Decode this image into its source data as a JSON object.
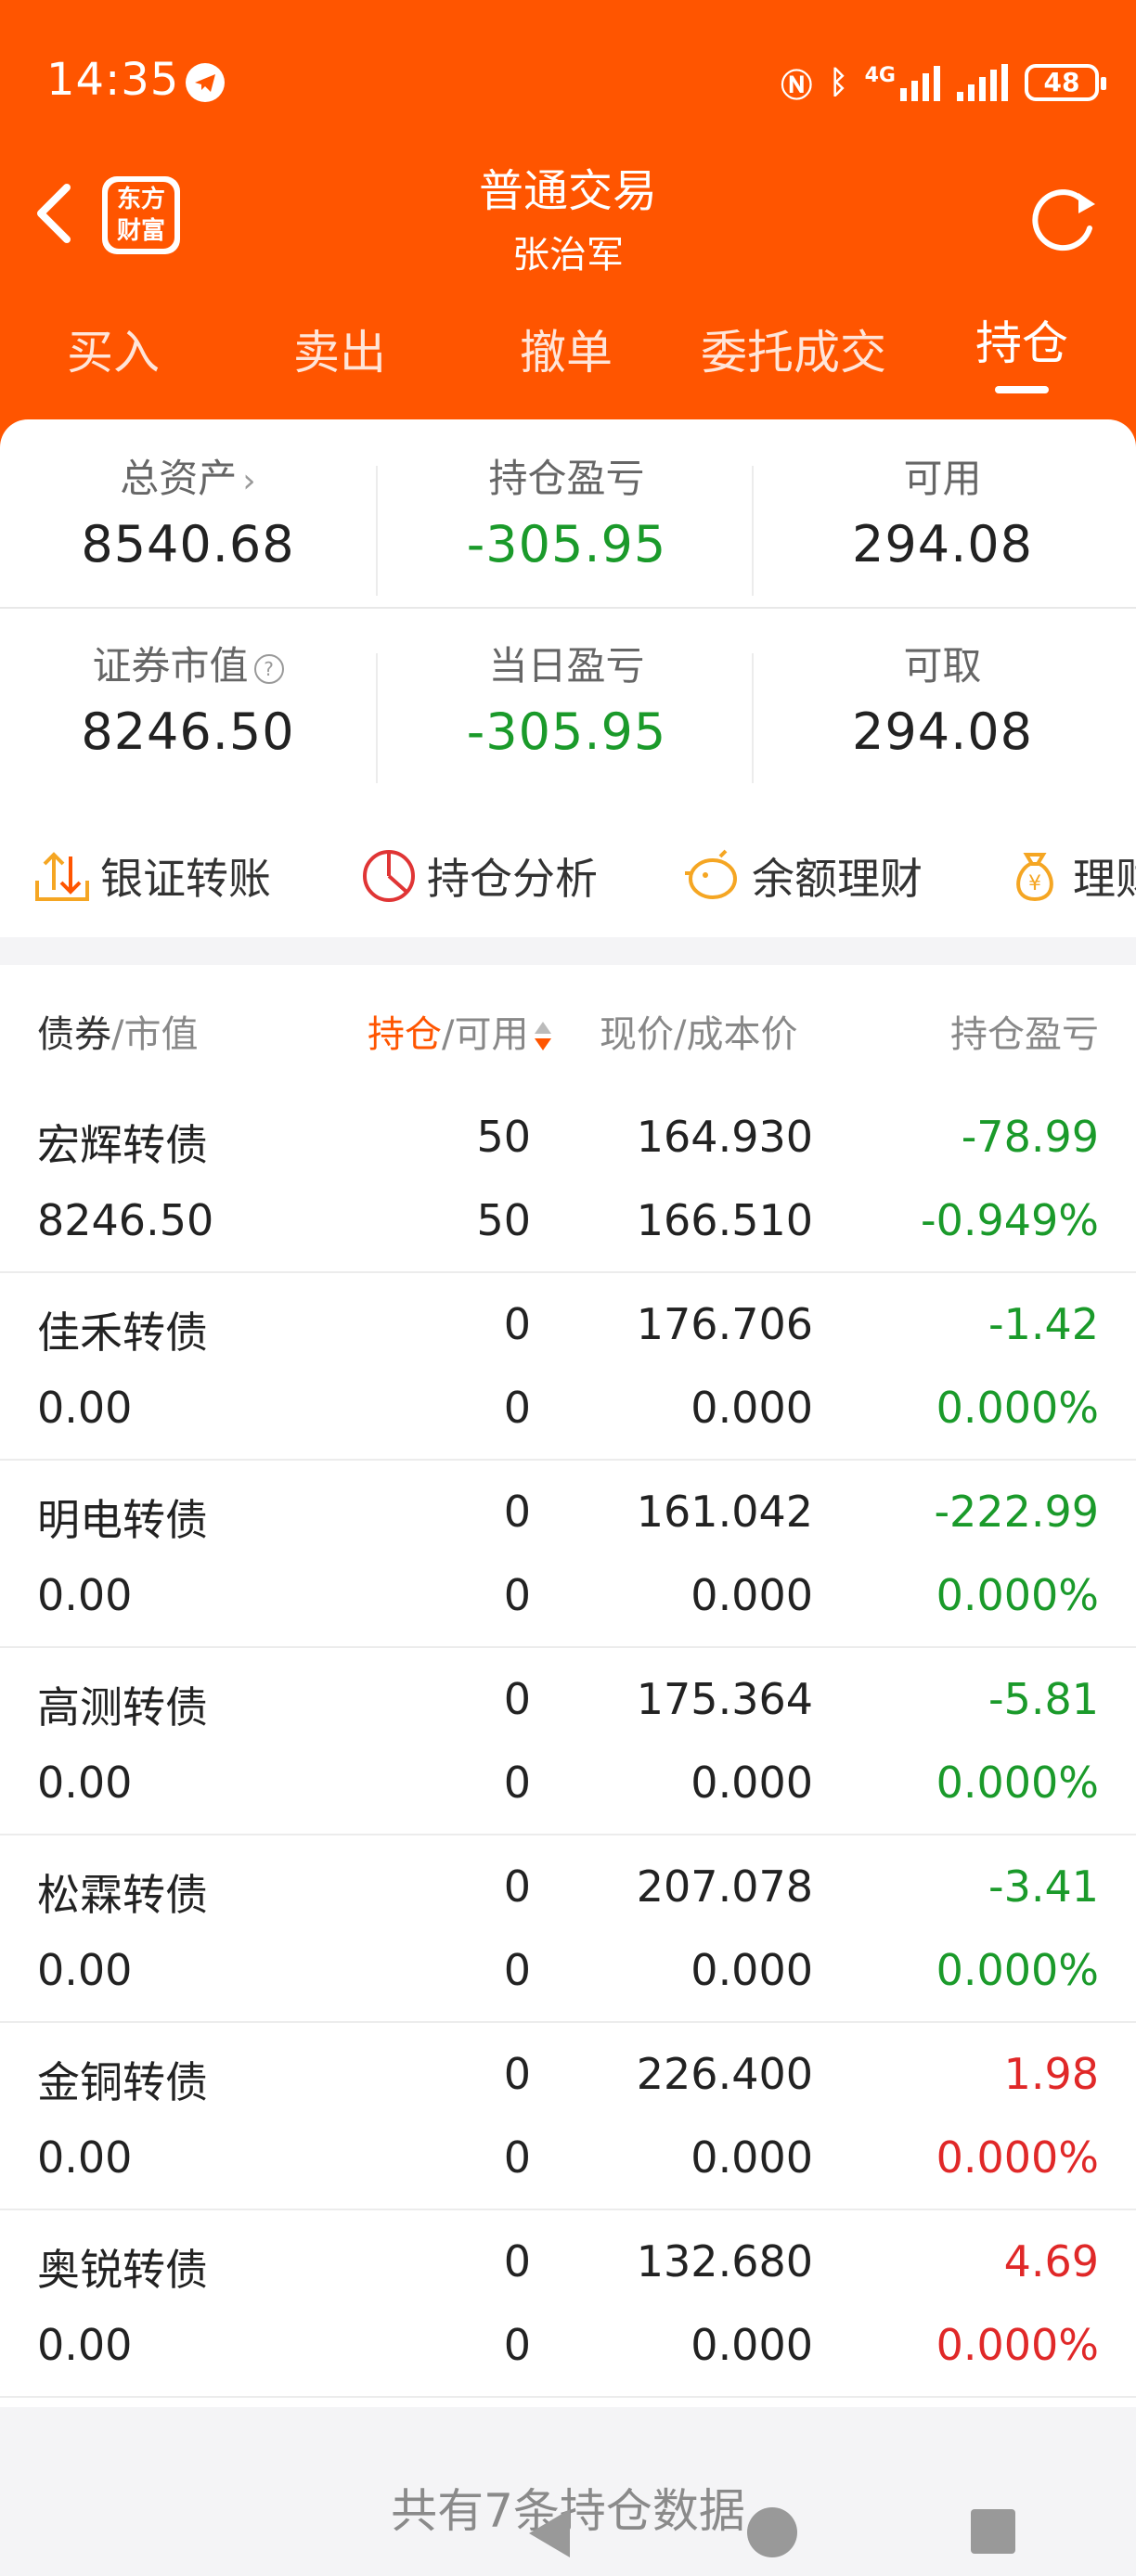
{
  "status": {
    "time": "14:35",
    "battery": "48",
    "network": "4G"
  },
  "nav": {
    "logo_line1": "东方",
    "logo_line2": "财富",
    "title": "普通交易",
    "subtitle": "张治军"
  },
  "tabs": [
    {
      "label": "买入"
    },
    {
      "label": "卖出"
    },
    {
      "label": "撤单"
    },
    {
      "label": "委托成交"
    },
    {
      "label": "持仓",
      "active": true
    }
  ],
  "summary": {
    "row1": [
      {
        "label": "总资产",
        "value": "8540.68"
      },
      {
        "label": "持仓盈亏",
        "value": "-305.95"
      },
      {
        "label": "可用",
        "value": "294.08"
      }
    ],
    "row2": [
      {
        "label": "证券市值",
        "value": "8246.50"
      },
      {
        "label": "当日盈亏",
        "value": "-305.95"
      },
      {
        "label": "可取",
        "value": "294.08"
      }
    ]
  },
  "quick_actions": [
    {
      "label": "银证转账",
      "icon": "transfer-icon"
    },
    {
      "label": "持仓分析",
      "icon": "pie-chart-icon"
    },
    {
      "label": "余额理财",
      "icon": "piggy-bank-icon"
    },
    {
      "label": "理财",
      "icon": "money-bag-icon"
    }
  ],
  "table": {
    "headers": {
      "name": "债券",
      "mv": "/市值",
      "hold": "持仓",
      "avail": "/可用",
      "price": "现价/成本价",
      "pl": "持仓盈亏"
    },
    "rows": [
      {
        "name": "宏辉转债",
        "market_value": "8246.50",
        "hold": "50",
        "avail": "50",
        "price": "164.930",
        "cost": "166.510",
        "pl": "-78.99",
        "pl_pct": "-0.949%",
        "pl_color": "green",
        "pct_color": "green"
      },
      {
        "name": "佳禾转债",
        "market_value": "0.00",
        "hold": "0",
        "avail": "0",
        "price": "176.706",
        "cost": "0.000",
        "pl": "-1.42",
        "pl_pct": "0.000%",
        "pl_color": "green",
        "pct_color": "green"
      },
      {
        "name": "明电转债",
        "market_value": "0.00",
        "hold": "0",
        "avail": "0",
        "price": "161.042",
        "cost": "0.000",
        "pl": "-222.99",
        "pl_pct": "0.000%",
        "pl_color": "green",
        "pct_color": "green"
      },
      {
        "name": "高测转债",
        "market_value": "0.00",
        "hold": "0",
        "avail": "0",
        "price": "175.364",
        "cost": "0.000",
        "pl": "-5.81",
        "pl_pct": "0.000%",
        "pl_color": "green",
        "pct_color": "green"
      },
      {
        "name": "松霖转债",
        "market_value": "0.00",
        "hold": "0",
        "avail": "0",
        "price": "207.078",
        "cost": "0.000",
        "pl": "-3.41",
        "pl_pct": "0.000%",
        "pl_color": "green",
        "pct_color": "green"
      },
      {
        "name": "金铜转债",
        "market_value": "0.00",
        "hold": "0",
        "avail": "0",
        "price": "226.400",
        "cost": "0.000",
        "pl": "1.98",
        "pl_pct": "0.000%",
        "pl_color": "red",
        "pct_color": "red"
      },
      {
        "name": "奥锐转债",
        "market_value": "0.00",
        "hold": "0",
        "avail": "0",
        "price": "132.680",
        "cost": "0.000",
        "pl": "4.69",
        "pl_pct": "0.000%",
        "pl_color": "red",
        "pct_color": "red"
      }
    ]
  },
  "footer": {
    "text": "共有7条持仓数据"
  },
  "colors": {
    "brand": "#ff5500",
    "gain": "#e02828",
    "loss": "#1a9a2a"
  }
}
